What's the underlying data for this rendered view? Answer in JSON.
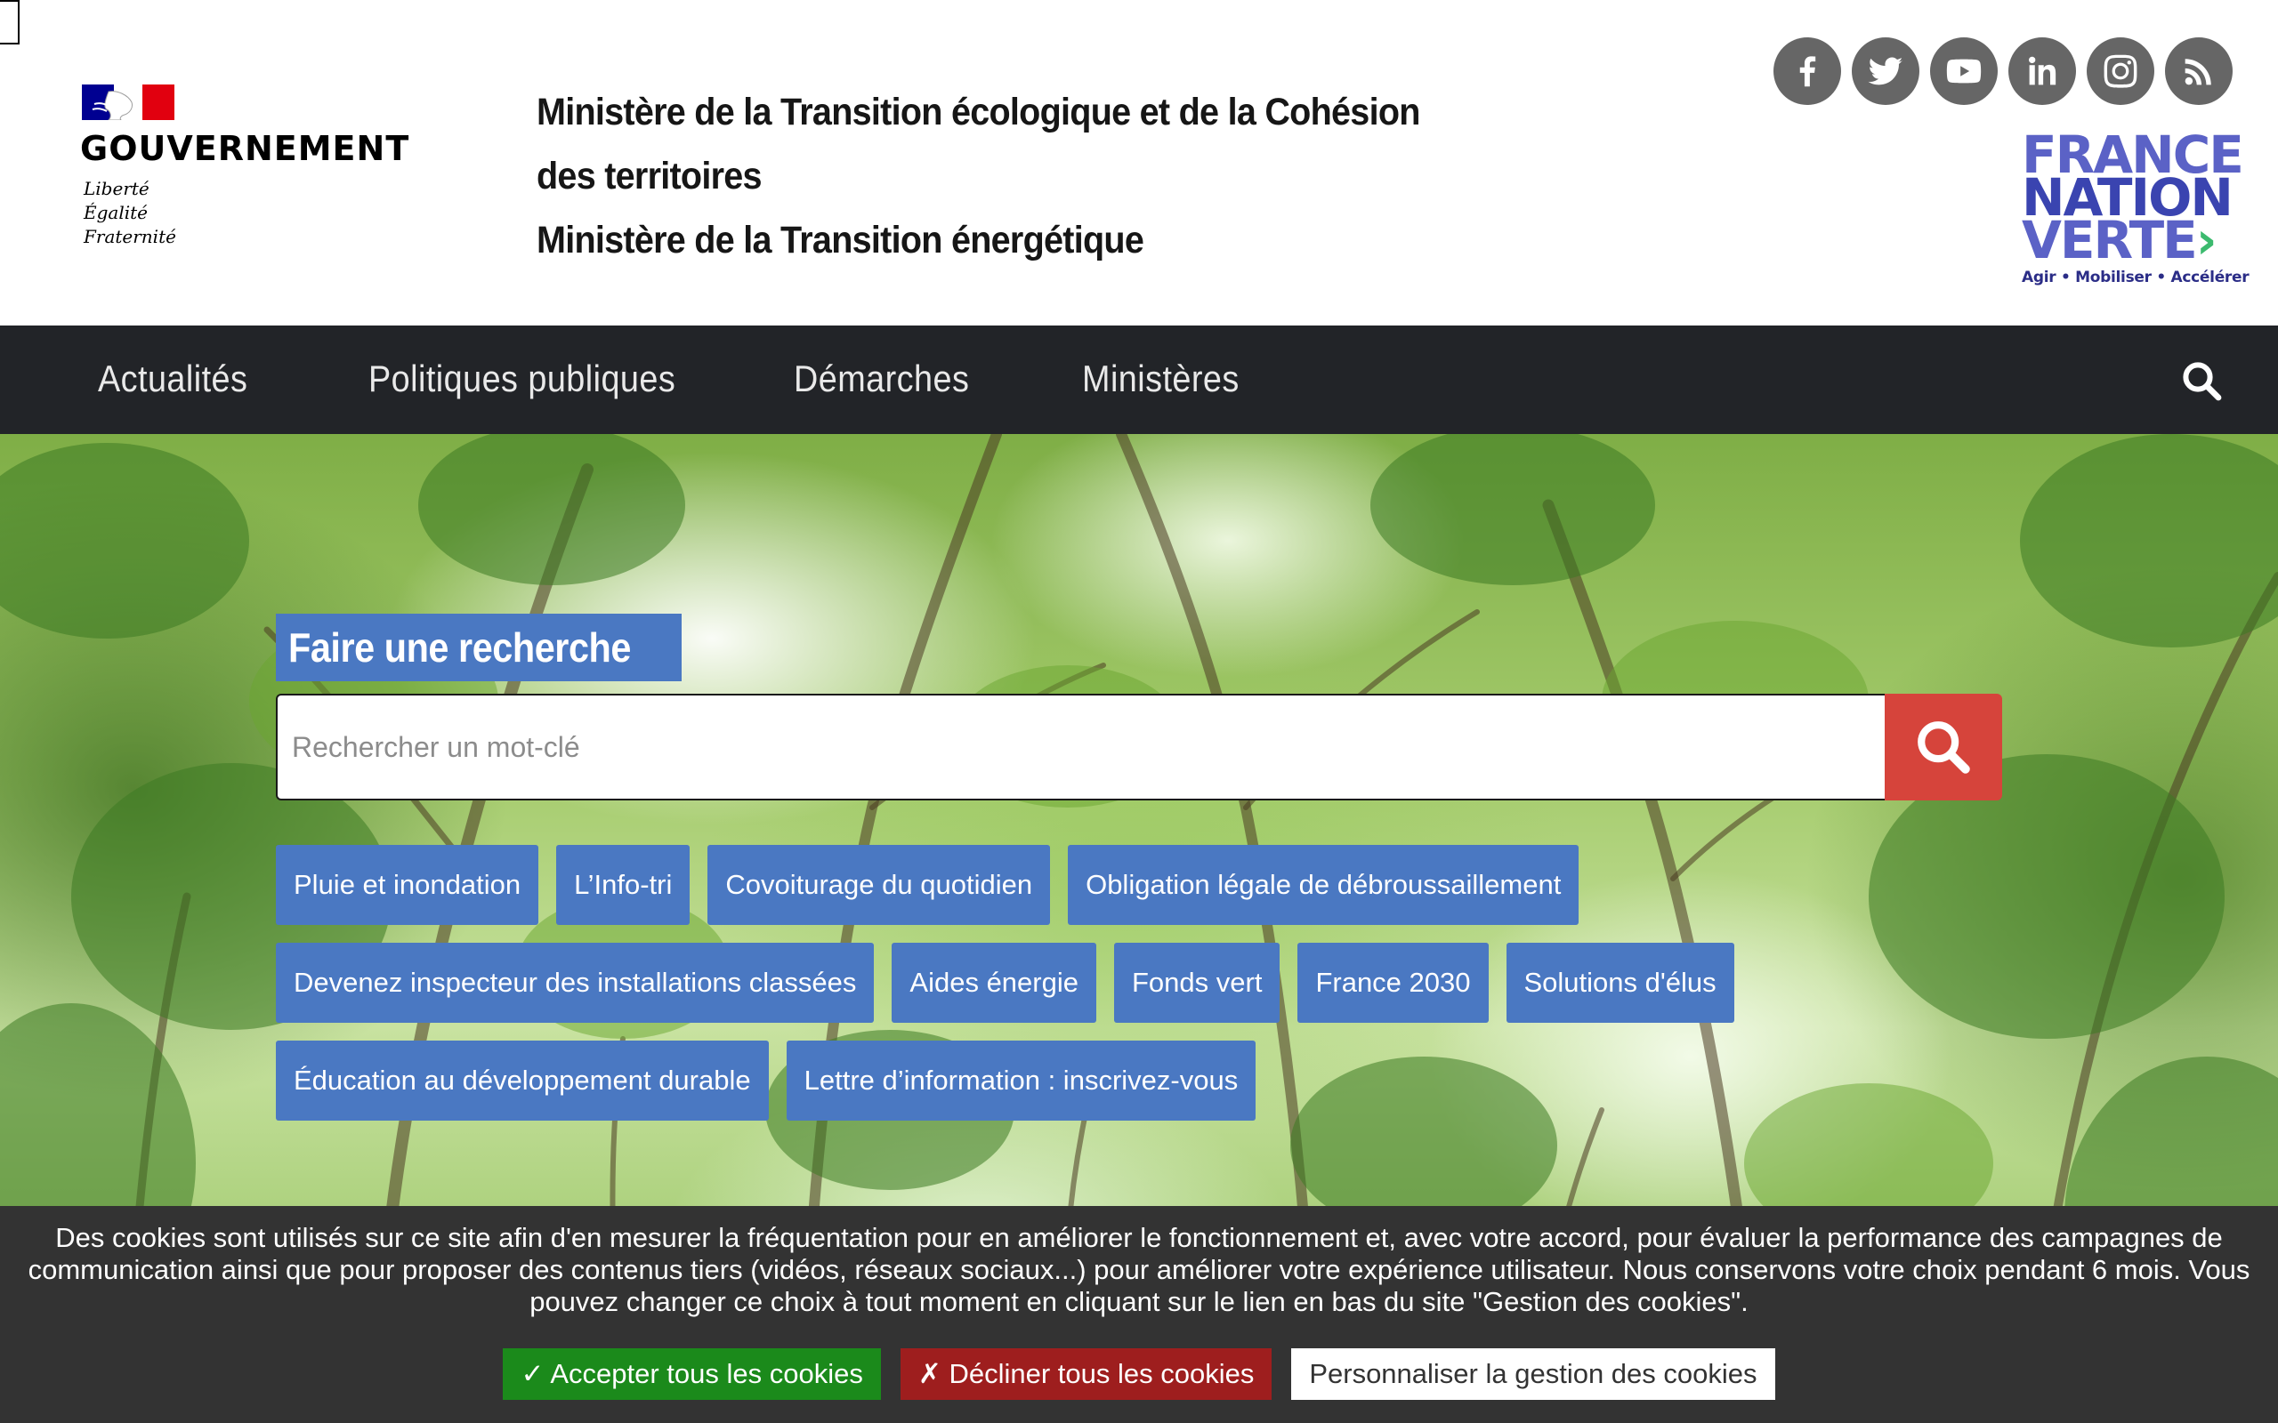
{
  "header": {
    "gov_logo_label": "GOUVERNEMENT",
    "motto": [
      "Liberté",
      "Égalité",
      "Fraternité"
    ],
    "ministry_lines": [
      "Ministère de la Transition écologique et de la Cohésion",
      "des territoires",
      "Ministère de la Transition énergétique"
    ],
    "social_icons": [
      "facebook-icon",
      "twitter-icon",
      "youtube-icon",
      "linkedin-icon",
      "instagram-icon",
      "rss-icon"
    ],
    "fnv_logo": {
      "lines": [
        "FRANCE",
        "NATION",
        "VERTE"
      ],
      "tagline": "Agir • Mobiliser • Accélérer"
    }
  },
  "nav": {
    "items": [
      "Actualités",
      "Politiques publiques",
      "Démarches",
      "Ministères"
    ],
    "search_icon": "search-icon"
  },
  "hero": {
    "search_title": "Faire une recherche",
    "search_placeholder": "Rechercher un mot-clé",
    "tags": [
      [
        "Pluie et inondation",
        "L’Info-tri",
        "Covoiturage du quotidien",
        "Obligation légale de débroussaillement"
      ],
      [
        "Devenez inspecteur des installations classées",
        "Aides énergie",
        "Fonds vert",
        "France 2030",
        "Solutions d'élus"
      ],
      [
        "Éducation au développement durable",
        "Lettre d’information : inscrivez-vous"
      ]
    ]
  },
  "cookie": {
    "text": "Des cookies sont utilisés sur ce site afin d'en mesurer la fréquentation pour en améliorer le fonctionnement et, avec votre accord, pour évaluer la performance des campagnes de communication ainsi que pour proposer des contenus tiers (vidéos, réseaux sociaux...) pour améliorer votre expérience utilisateur. Nous conservons votre choix pendant 6 mois. Vous pouvez changer ce choix à tout moment en cliquant sur le lien en bas du site \"Gestion des cookies\".",
    "accept_label": "✓ Accepter tous les cookies",
    "decline_label": "✗ Décliner tous les cookies",
    "custom_label": "Personnaliser la gestion des cookies"
  },
  "colors": {
    "nav_bg": "#222428",
    "tag_bg": "#4a78c2",
    "search_btn": "#d6443b",
    "cookie_bg": "#333333",
    "accept": "#1b8a1b",
    "decline": "#9e1e1e"
  }
}
